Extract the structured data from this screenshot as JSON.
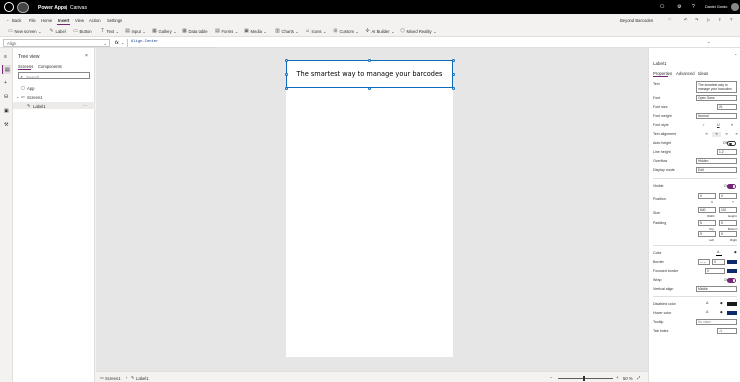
{
  "app": {
    "title": "Power Apps",
    "separator": "|",
    "mode": "Canvas",
    "user": "Daniel Gordo"
  },
  "menu": {
    "back": "Back",
    "items": [
      "File",
      "Home",
      "Insert",
      "View",
      "Action",
      "Settings"
    ],
    "active": "Insert",
    "app_name": "Beyond Barcodes"
  },
  "ribbon": {
    "items": [
      "New screen",
      "Label",
      "Button",
      "Text",
      "Input",
      "Gallery",
      "Data table",
      "Forms",
      "Media",
      "Charts",
      "Icons",
      "Custom",
      "AI Builder",
      "Mixed Reality"
    ]
  },
  "formula": {
    "property": "Align",
    "fx": "fx",
    "value": "Align.Center",
    "hint_expr": "Align.Center",
    "hint_eq": "=",
    "hint_val": "center",
    "datatype_label": "Data type:",
    "datatype_val": "text"
  },
  "tree": {
    "title": "Tree view",
    "tabs": [
      "Screens",
      "Components"
    ],
    "search_placeholder": "Search",
    "items": [
      "App",
      "Screen1",
      "Label1"
    ],
    "selected": "Label1"
  },
  "canvas": {
    "label_text": "The smartest way to manage your barcodes"
  },
  "status": {
    "screen": "Screen1",
    "control": "Label1",
    "zoom": "50 %"
  },
  "props": {
    "control": "Label1",
    "tabs": [
      "Properties",
      "Advanced",
      "Ideas"
    ],
    "text_label": "Text",
    "text_value": "The smartest way to manage your barcodes",
    "font_label": "Font",
    "font_value": "Open Sans",
    "fontsize_label": "Font size",
    "fontsize_value": "21",
    "fontweight_label": "Font weight",
    "fontweight_value": "Normal",
    "fontstyle_label": "Font style",
    "style_icons": [
      "/",
      "U",
      "≡"
    ],
    "align_label": "Text alignment",
    "autoheight_label": "Auto height",
    "autoheight_value": "Off",
    "lineheight_label": "Line height",
    "lineheight_value": "1.2",
    "overflow_label": "Overflow",
    "overflow_value": "Hidden",
    "displaymode_label": "Display mode",
    "displaymode_value": "Edit",
    "visible_label": "Visible",
    "visible_value": "On",
    "position_label": "Position",
    "x_value": "0",
    "y_value": "0",
    "x_caption": "X",
    "y_caption": "Y",
    "size_label": "Size",
    "w_value": "640",
    "h_value": "110",
    "w_caption": "Width",
    "h_caption": "Height",
    "padding_label": "Padding",
    "pt_value": "5",
    "pb_value": "5",
    "pl_value": "5",
    "pr_value": "5",
    "pt_caption": "Top",
    "pb_caption": "Bottom",
    "pl_caption": "Left",
    "pr_caption": "Right",
    "color_label": "Color",
    "border_label": "Border",
    "border_value": "0",
    "focused_label": "Focused border",
    "focused_value": "0",
    "wrap_label": "Wrap",
    "wrap_value": "On",
    "valign_label": "Vertical align",
    "valign_value": "Middle",
    "disabled_label": "Disabled color",
    "hover_label": "Hover color",
    "tooltip_label": "Tooltip",
    "tooltip_value": "No value",
    "tabindex_label": "Tab index",
    "tabindex_value": "-1"
  },
  "colors": {
    "accent": "#742774",
    "navy": "#0f2a6b",
    "toggle_on": "#742774"
  }
}
